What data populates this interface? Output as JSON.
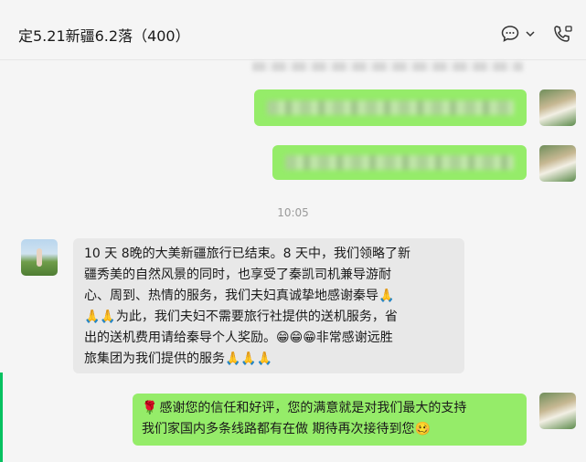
{
  "header": {
    "title": "定5.21新疆6.2落（400）",
    "icons": [
      "chat-bubble-icon",
      "chevron-down-icon",
      "phone-video-icon"
    ]
  },
  "chat": {
    "timestamp": "10:05",
    "messages": [
      {
        "sender": "self",
        "blurred": true
      },
      {
        "sender": "self",
        "blurred": true
      },
      {
        "sender": "other",
        "text": "10 天 8晚的大美新疆旅行已结束。8 天中，我们领略了新\n疆秀美的自然风景的同时，也享受了秦凯司机兼导游耐\n心、周到、热情的服务，我们夫妇真诚挚地感谢秦导🙏\n🙏🙏为此，我们夫妇不需要旅行社提供的送机服务，省\n出的送机费用请给秦导个人奖励。😁😁😁非常感谢远胜\n旅集团为我们提供的服务🙏🙏🙏"
      },
      {
        "sender": "self",
        "icon": "rose-icon",
        "text": "感谢您的信任和好评，您的满意就是对我们最大的支持\n我们家国内多条线路都有在做 期待再次接待到您🥴"
      }
    ]
  }
}
